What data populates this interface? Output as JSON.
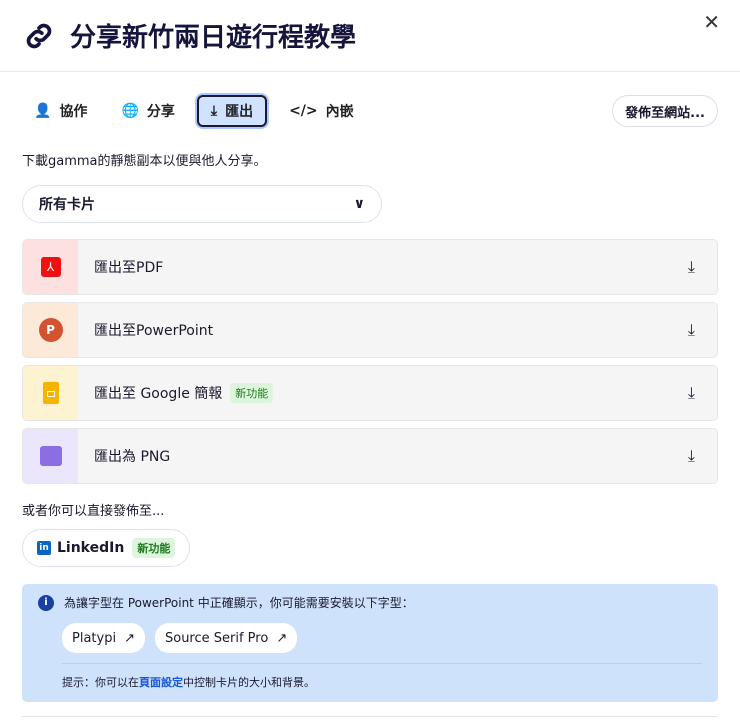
{
  "header": {
    "title": "分享新竹兩日遊行程教學",
    "close": "✕"
  },
  "tabs": [
    {
      "label": "協作",
      "icon": "user-plus-icon"
    },
    {
      "label": "分享",
      "icon": "globe-icon"
    },
    {
      "label": "匯出",
      "icon": "download-icon",
      "active": true
    },
    {
      "label": "內嵌",
      "icon": "code-icon"
    }
  ],
  "publish_label": "發佈至網站...",
  "description": "下載gamma的靜態副本以便與他人分享。",
  "select": {
    "value": "所有卡片"
  },
  "exports": [
    {
      "label": "匯出至PDF",
      "icon": "pdf-icon",
      "color": "#fde0e0"
    },
    {
      "label": "匯出至PowerPoint",
      "icon": "powerpoint-icon",
      "color": "#fde9d8"
    },
    {
      "label": "匯出至 Google 簡報",
      "icon": "google-slides-icon",
      "color": "#fdf3d0",
      "badge": "新功能"
    },
    {
      "label": "匯出為 PNG",
      "icon": "image-icon",
      "color": "#ebe6fb"
    }
  ],
  "or_text": "或者你可以直接發佈至...",
  "linkedin": {
    "label": "LinkedIn",
    "badge": "新功能"
  },
  "info": {
    "text": "為讓字型在 PowerPoint 中正確顯示，你可能需要安裝以下字型：",
    "fonts": [
      "Platypi",
      "Source Serif Pro"
    ],
    "tip_prefix": "提示：你可以在",
    "tip_link": "頁面設定",
    "tip_suffix": "中控制卡片的大小和背景。"
  }
}
